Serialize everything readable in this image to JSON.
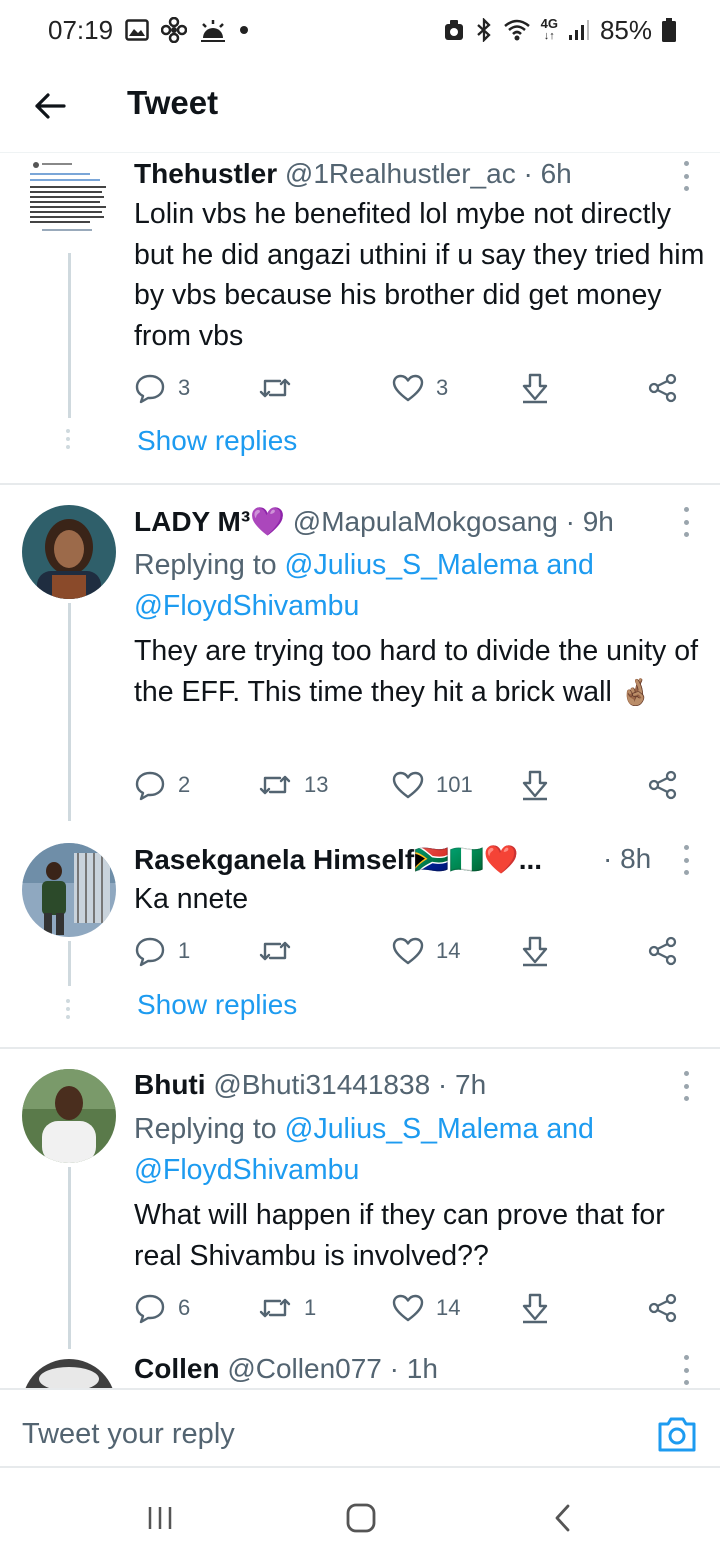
{
  "status_bar": {
    "time": "07:19",
    "network": "4G",
    "battery": "85%"
  },
  "header": {
    "title": "Tweet"
  },
  "tweets": [
    {
      "name": "Thehustler",
      "handle": "@1Realhustler_ac",
      "time": "· 6h",
      "text": "Lolin vbs he benefited lol mybe not directly but he did angazi uthini if u say they tried him by vbs because his brother did get money from vbs",
      "replies": "3",
      "retweets": "",
      "likes": "3",
      "show_replies": "Show replies",
      "avatar_tiny_text": "Abantu baKITH bayagenga I have fallen victim in SA from our citizens"
    },
    {
      "name": "LADY M³💜",
      "handle": "@MapulaMokgosang",
      "time": "· 9h",
      "replying_prefix": "Replying to",
      "reply_to_1": "@Julius_S_Malema",
      "reply_and": "and",
      "reply_to_2": "@FloydShivambu",
      "text": "They are trying too hard to divide the unity of the EFF. This time they hit a brick wall",
      "emoji": "🤞🏽",
      "replies": "2",
      "retweets": "13",
      "likes": "101"
    },
    {
      "name": "Rasekganela Himself🇿🇦🇳🇬❤️...",
      "handle": "",
      "time": "· 8h",
      "text": "Ka nnete",
      "replies": "1",
      "retweets": "",
      "likes": "14",
      "show_replies": "Show replies"
    },
    {
      "name": "Bhuti",
      "handle": "@Bhuti31441838",
      "time": "· 7h",
      "replying_prefix": "Replying to",
      "reply_to_1": "@Julius_S_Malema",
      "reply_and": "and",
      "reply_to_2": "@FloydShivambu",
      "text": "What will happen if they can prove that for real Shivambu is involved??",
      "replies": "6",
      "retweets": "1",
      "likes": "14"
    },
    {
      "name": "Collen",
      "handle": "@Collen077",
      "time": "· 1h"
    }
  ],
  "reply_bar": {
    "placeholder": "Tweet your reply"
  },
  "colors": {
    "link": "#1d9bf0",
    "secondary_text": "#536471",
    "divider": "#e7eaec"
  }
}
